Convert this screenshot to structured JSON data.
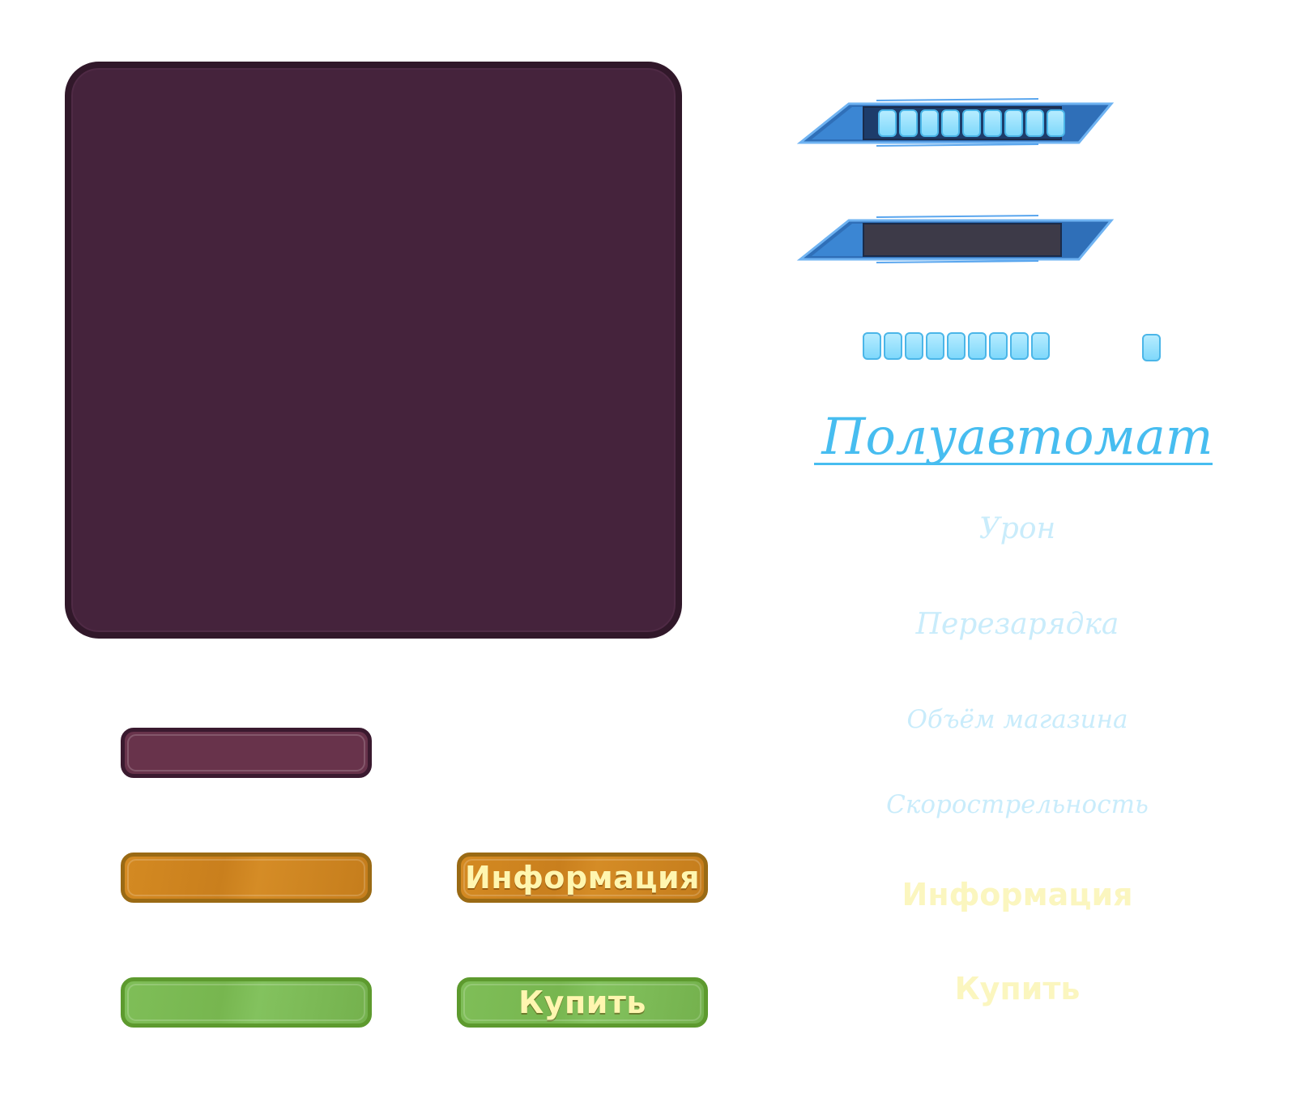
{
  "buttons": {
    "info_label": "Информация",
    "buy_label": "Купить"
  },
  "weapon": {
    "name": "Полуавтомат",
    "stats": [
      "Урон",
      "Перезарядка",
      "Объём магазина",
      "Скорострельность"
    ]
  },
  "ghost_labels": {
    "info": "Информация",
    "buy": "Купить"
  },
  "gauges": {
    "full_segments": 9,
    "empty_segments": 0,
    "sample_segments": 9,
    "single_segment": 1
  },
  "colors": {
    "panel": "#45233c",
    "plum_button": "#68334b",
    "orange_button": "#d48a22",
    "green_button": "#7fbe58",
    "accent_blue": "#47bdf0",
    "label_yellow": "#fff6b0"
  }
}
